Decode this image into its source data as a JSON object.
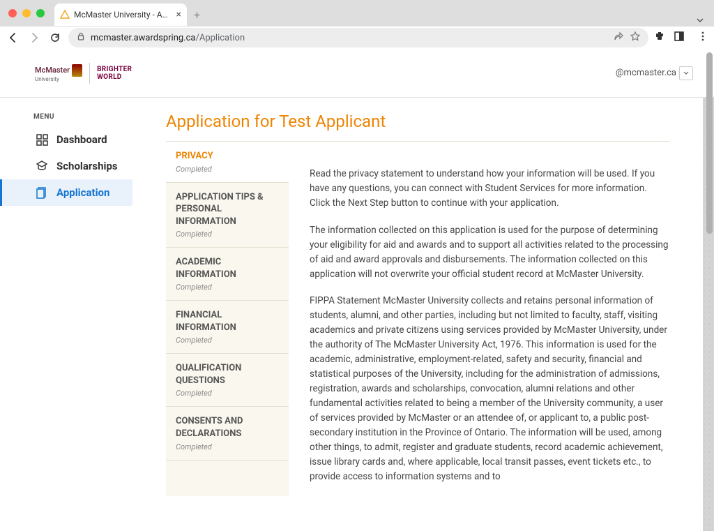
{
  "browser": {
    "tab_title": "McMaster University - Applicat",
    "url_host": "mcmaster.awardspring.ca",
    "url_path": "/Application"
  },
  "header": {
    "logo_line1": "McMaster",
    "logo_line2": "University",
    "logo_bw_line1": "BRIGHTER",
    "logo_bw_line2": "WORLD",
    "user_label": "@mcmaster.ca"
  },
  "sidebar": {
    "menu_label": "MENU",
    "items": [
      {
        "label": "Dashboard",
        "active": false
      },
      {
        "label": "Scholarships",
        "active": false
      },
      {
        "label": "Application",
        "active": true
      }
    ]
  },
  "page_title": "Application for Test Applicant",
  "steps": [
    {
      "title": "PRIVACY",
      "status": "Completed",
      "active": true
    },
    {
      "title": "APPLICATION TIPS & PERSONAL INFORMATION",
      "status": "Completed",
      "active": false
    },
    {
      "title": "ACADEMIC INFORMATION",
      "status": "Completed",
      "active": false
    },
    {
      "title": "FINANCIAL INFORMATION",
      "status": "Completed",
      "active": false
    },
    {
      "title": "QUALIFICATION QUESTIONS",
      "status": "Completed",
      "active": false
    },
    {
      "title": "CONSENTS AND DECLARATIONS",
      "status": "Completed",
      "active": false
    }
  ],
  "detail": {
    "p1": "Read the privacy statement to understand how your information will be used. If you have any questions, you can connect with Student Services for more information. Click the Next Step button to continue with your application.",
    "p2": "The information collected on this application is used for the purpose of determining your eligibility for aid and awards and to support all activities related to the processing of aid and award approvals and disbursements.  The information collected on this application will not overwrite your official student record at McMaster University.",
    "p3": "FIPPA Statement McMaster University collects and retains personal information of students, alumni, and other parties, including but not limited to faculty, staff, visiting academics and private citizens using services provided by McMaster University, under the authority of The McMaster University Act, 1976. This information is used for the academic, administrative, employment-related, safety and security, financial and statistical purposes of the University, including for the administration of admissions, registration, awards and scholarships, convocation, alumni relations and other fundamental activities related to being a member of the University community, a user of services provided by McMaster or an attendee of, or applicant to, a public post-secondary institution in the Province of Ontario. The information will be used, among other things, to admit, register and graduate students, record academic achievement, issue library cards and, where applicable, local transit passes, event tickets etc., to provide access to information systems and to"
  }
}
